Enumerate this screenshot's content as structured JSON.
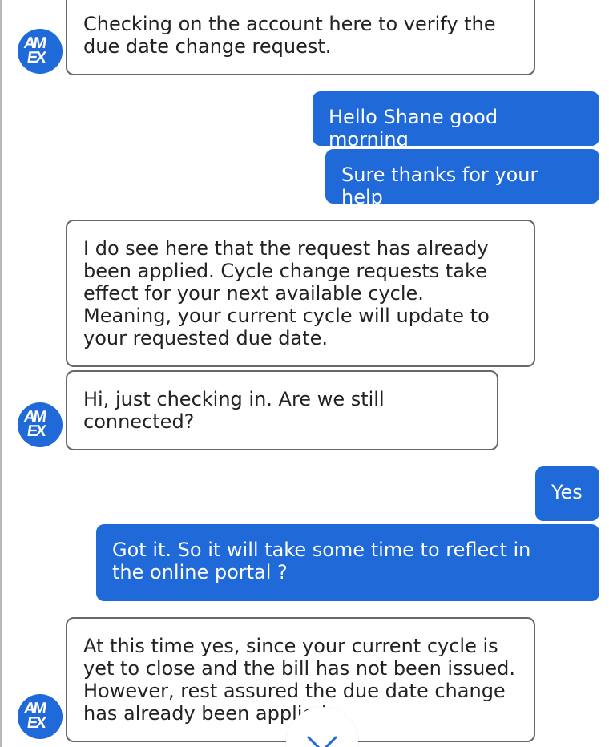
{
  "brand": {
    "logo_top": "AM",
    "logo_bottom": "EX",
    "accent_color": "#1f69d8"
  },
  "chat": {
    "messages": [
      {
        "sender": "agent",
        "text": "Checking on the account here to verify the due date change request."
      },
      {
        "sender": "user",
        "text": "Hello Shane good morning"
      },
      {
        "sender": "user",
        "text": "Sure thanks for your help"
      },
      {
        "sender": "agent",
        "text": "I do see here that the request has already been applied. Cycle change requests take effect for your next available cycle. Meaning, your current cycle will update to your requested due date."
      },
      {
        "sender": "agent",
        "text": "Hi, just checking in. Are we still connected?"
      },
      {
        "sender": "user",
        "text": "Yes"
      },
      {
        "sender": "user",
        "text": "Got it. So it will take some time to reflect in the online portal ?"
      },
      {
        "sender": "agent",
        "text": "At this time yes, since your current cycle is yet to close and the bill has not been issued. However, rest assured the due date change has already been applied"
      }
    ]
  },
  "controls": {
    "scroll_down_icon": "chevron-down-icon"
  }
}
